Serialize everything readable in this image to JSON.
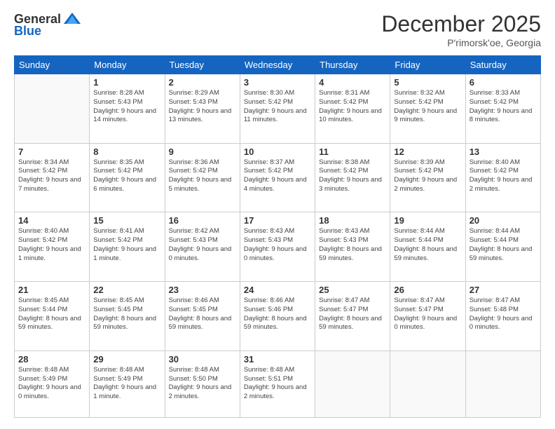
{
  "header": {
    "logo_general": "General",
    "logo_blue": "Blue",
    "month": "December 2025",
    "location": "P'rimorsk'oe, Georgia"
  },
  "calendar": {
    "days_of_week": [
      "Sunday",
      "Monday",
      "Tuesday",
      "Wednesday",
      "Thursday",
      "Friday",
      "Saturday"
    ],
    "weeks": [
      [
        {
          "day": "",
          "sunrise": "",
          "sunset": "",
          "daylight": ""
        },
        {
          "day": "1",
          "sunrise": "Sunrise: 8:28 AM",
          "sunset": "Sunset: 5:43 PM",
          "daylight": "Daylight: 9 hours and 14 minutes."
        },
        {
          "day": "2",
          "sunrise": "Sunrise: 8:29 AM",
          "sunset": "Sunset: 5:43 PM",
          "daylight": "Daylight: 9 hours and 13 minutes."
        },
        {
          "day": "3",
          "sunrise": "Sunrise: 8:30 AM",
          "sunset": "Sunset: 5:42 PM",
          "daylight": "Daylight: 9 hours and 11 minutes."
        },
        {
          "day": "4",
          "sunrise": "Sunrise: 8:31 AM",
          "sunset": "Sunset: 5:42 PM",
          "daylight": "Daylight: 9 hours and 10 minutes."
        },
        {
          "day": "5",
          "sunrise": "Sunrise: 8:32 AM",
          "sunset": "Sunset: 5:42 PM",
          "daylight": "Daylight: 9 hours and 9 minutes."
        },
        {
          "day": "6",
          "sunrise": "Sunrise: 8:33 AM",
          "sunset": "Sunset: 5:42 PM",
          "daylight": "Daylight: 9 hours and 8 minutes."
        }
      ],
      [
        {
          "day": "7",
          "sunrise": "Sunrise: 8:34 AM",
          "sunset": "Sunset: 5:42 PM",
          "daylight": "Daylight: 9 hours and 7 minutes."
        },
        {
          "day": "8",
          "sunrise": "Sunrise: 8:35 AM",
          "sunset": "Sunset: 5:42 PM",
          "daylight": "Daylight: 9 hours and 6 minutes."
        },
        {
          "day": "9",
          "sunrise": "Sunrise: 8:36 AM",
          "sunset": "Sunset: 5:42 PM",
          "daylight": "Daylight: 9 hours and 5 minutes."
        },
        {
          "day": "10",
          "sunrise": "Sunrise: 8:37 AM",
          "sunset": "Sunset: 5:42 PM",
          "daylight": "Daylight: 9 hours and 4 minutes."
        },
        {
          "day": "11",
          "sunrise": "Sunrise: 8:38 AM",
          "sunset": "Sunset: 5:42 PM",
          "daylight": "Daylight: 9 hours and 3 minutes."
        },
        {
          "day": "12",
          "sunrise": "Sunrise: 8:39 AM",
          "sunset": "Sunset: 5:42 PM",
          "daylight": "Daylight: 9 hours and 2 minutes."
        },
        {
          "day": "13",
          "sunrise": "Sunrise: 8:40 AM",
          "sunset": "Sunset: 5:42 PM",
          "daylight": "Daylight: 9 hours and 2 minutes."
        }
      ],
      [
        {
          "day": "14",
          "sunrise": "Sunrise: 8:40 AM",
          "sunset": "Sunset: 5:42 PM",
          "daylight": "Daylight: 9 hours and 1 minute."
        },
        {
          "day": "15",
          "sunrise": "Sunrise: 8:41 AM",
          "sunset": "Sunset: 5:42 PM",
          "daylight": "Daylight: 9 hours and 1 minute."
        },
        {
          "day": "16",
          "sunrise": "Sunrise: 8:42 AM",
          "sunset": "Sunset: 5:43 PM",
          "daylight": "Daylight: 9 hours and 0 minutes."
        },
        {
          "day": "17",
          "sunrise": "Sunrise: 8:43 AM",
          "sunset": "Sunset: 5:43 PM",
          "daylight": "Daylight: 9 hours and 0 minutes."
        },
        {
          "day": "18",
          "sunrise": "Sunrise: 8:43 AM",
          "sunset": "Sunset: 5:43 PM",
          "daylight": "Daylight: 8 hours and 59 minutes."
        },
        {
          "day": "19",
          "sunrise": "Sunrise: 8:44 AM",
          "sunset": "Sunset: 5:44 PM",
          "daylight": "Daylight: 8 hours and 59 minutes."
        },
        {
          "day": "20",
          "sunrise": "Sunrise: 8:44 AM",
          "sunset": "Sunset: 5:44 PM",
          "daylight": "Daylight: 8 hours and 59 minutes."
        }
      ],
      [
        {
          "day": "21",
          "sunrise": "Sunrise: 8:45 AM",
          "sunset": "Sunset: 5:44 PM",
          "daylight": "Daylight: 8 hours and 59 minutes."
        },
        {
          "day": "22",
          "sunrise": "Sunrise: 8:45 AM",
          "sunset": "Sunset: 5:45 PM",
          "daylight": "Daylight: 8 hours and 59 minutes."
        },
        {
          "day": "23",
          "sunrise": "Sunrise: 8:46 AM",
          "sunset": "Sunset: 5:45 PM",
          "daylight": "Daylight: 8 hours and 59 minutes."
        },
        {
          "day": "24",
          "sunrise": "Sunrise: 8:46 AM",
          "sunset": "Sunset: 5:46 PM",
          "daylight": "Daylight: 8 hours and 59 minutes."
        },
        {
          "day": "25",
          "sunrise": "Sunrise: 8:47 AM",
          "sunset": "Sunset: 5:47 PM",
          "daylight": "Daylight: 8 hours and 59 minutes."
        },
        {
          "day": "26",
          "sunrise": "Sunrise: 8:47 AM",
          "sunset": "Sunset: 5:47 PM",
          "daylight": "Daylight: 9 hours and 0 minutes."
        },
        {
          "day": "27",
          "sunrise": "Sunrise: 8:47 AM",
          "sunset": "Sunset: 5:48 PM",
          "daylight": "Daylight: 9 hours and 0 minutes."
        }
      ],
      [
        {
          "day": "28",
          "sunrise": "Sunrise: 8:48 AM",
          "sunset": "Sunset: 5:49 PM",
          "daylight": "Daylight: 9 hours and 0 minutes."
        },
        {
          "day": "29",
          "sunrise": "Sunrise: 8:48 AM",
          "sunset": "Sunset: 5:49 PM",
          "daylight": "Daylight: 9 hours and 1 minute."
        },
        {
          "day": "30",
          "sunrise": "Sunrise: 8:48 AM",
          "sunset": "Sunset: 5:50 PM",
          "daylight": "Daylight: 9 hours and 2 minutes."
        },
        {
          "day": "31",
          "sunrise": "Sunrise: 8:48 AM",
          "sunset": "Sunset: 5:51 PM",
          "daylight": "Daylight: 9 hours and 2 minutes."
        },
        {
          "day": "",
          "sunrise": "",
          "sunset": "",
          "daylight": ""
        },
        {
          "day": "",
          "sunrise": "",
          "sunset": "",
          "daylight": ""
        },
        {
          "day": "",
          "sunrise": "",
          "sunset": "",
          "daylight": ""
        }
      ]
    ]
  }
}
